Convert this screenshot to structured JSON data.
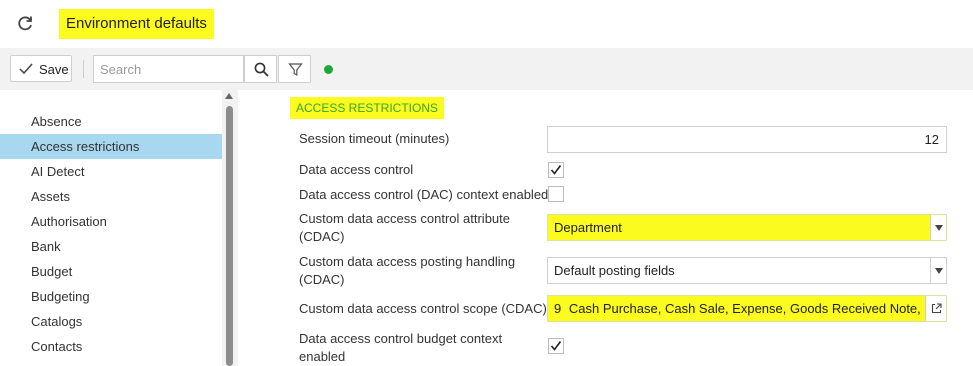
{
  "header": {
    "title": "Environment defaults",
    "refresh_icon": "refresh-icon"
  },
  "toolbar": {
    "save_label": "Save",
    "search_placeholder": "Search",
    "search_icon": "search-icon",
    "filter_icon": "filter-icon",
    "status_color": "#1ea83c"
  },
  "sidebar": {
    "items": [
      {
        "label": "Absence",
        "active": false
      },
      {
        "label": "Access restrictions",
        "active": true
      },
      {
        "label": "AI Detect",
        "active": false
      },
      {
        "label": "Assets",
        "active": false
      },
      {
        "label": "Authorisation",
        "active": false
      },
      {
        "label": "Bank",
        "active": false
      },
      {
        "label": "Budget",
        "active": false
      },
      {
        "label": "Budgeting",
        "active": false
      },
      {
        "label": "Catalogs",
        "active": false
      },
      {
        "label": "Contacts",
        "active": false
      }
    ]
  },
  "main": {
    "section_title": "ACCESS RESTRICTIONS",
    "fields": {
      "session_timeout": {
        "label": "Session timeout (minutes)",
        "value": "12"
      },
      "dac": {
        "label": "Data access control",
        "checked": true
      },
      "dac_context": {
        "label": "Data access control (DAC) context enabled",
        "checked": false
      },
      "cdac_attribute": {
        "label_line1": "Custom data access control attribute",
        "label_line2": "(CDAC)",
        "value": "Department"
      },
      "cdac_posting": {
        "label_line1": "Custom data access posting handling",
        "label_line2": "(CDAC)",
        "value": "Default posting fields"
      },
      "cdac_scope": {
        "label": "Custom data access control scope (CDAC)",
        "count": "9",
        "value": "Cash Purchase, Cash Sale, Expense, Goods Received Note, Pur"
      },
      "dac_budget": {
        "label_line1": "Data access control budget context",
        "label_line2": "enabled",
        "checked": true
      }
    }
  },
  "colors": {
    "highlight": "#fbfb1f",
    "active_nav": "#a8d7f0",
    "section_title": "#3aa62c"
  }
}
